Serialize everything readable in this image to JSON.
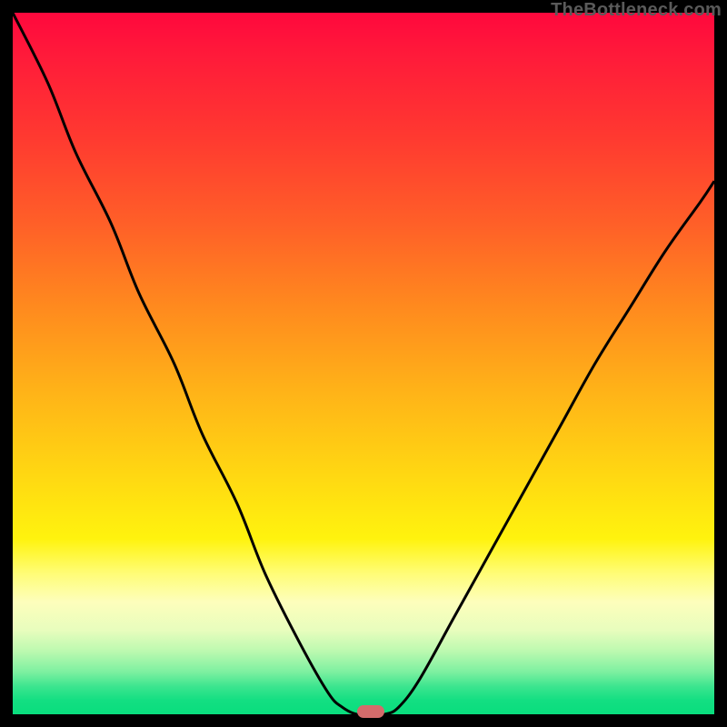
{
  "attribution": "TheBottleneck.com",
  "colors": {
    "curve_stroke": "#000000",
    "marker_fill": "#d46b6b",
    "gradient_top": "#ff083d",
    "gradient_bottom": "#09dd7d",
    "frame": "#000000"
  },
  "chart_data": {
    "type": "line",
    "title": "",
    "xlabel": "",
    "ylabel": "",
    "xlim": [
      0,
      1
    ],
    "ylim": [
      0,
      1
    ],
    "series": [
      {
        "name": "bottleneck-curve",
        "x": [
          0.0,
          0.05,
          0.09,
          0.14,
          0.18,
          0.23,
          0.27,
          0.32,
          0.36,
          0.41,
          0.45,
          0.47,
          0.49,
          0.51,
          0.53,
          0.55,
          0.58,
          0.63,
          0.68,
          0.73,
          0.78,
          0.83,
          0.88,
          0.93,
          0.98,
          1.0
        ],
        "values": [
          1.0,
          0.9,
          0.8,
          0.7,
          0.6,
          0.5,
          0.4,
          0.3,
          0.2,
          0.1,
          0.03,
          0.01,
          0.0,
          0.0,
          0.0,
          0.01,
          0.05,
          0.14,
          0.23,
          0.32,
          0.41,
          0.5,
          0.58,
          0.66,
          0.73,
          0.76
        ]
      }
    ],
    "annotations": [
      {
        "name": "optimal-marker",
        "x": 0.51,
        "y": 0.0,
        "shape": "rounded-pill",
        "color": "#d46b6b"
      }
    ],
    "background": "vertical-gradient red→yellow→green"
  }
}
